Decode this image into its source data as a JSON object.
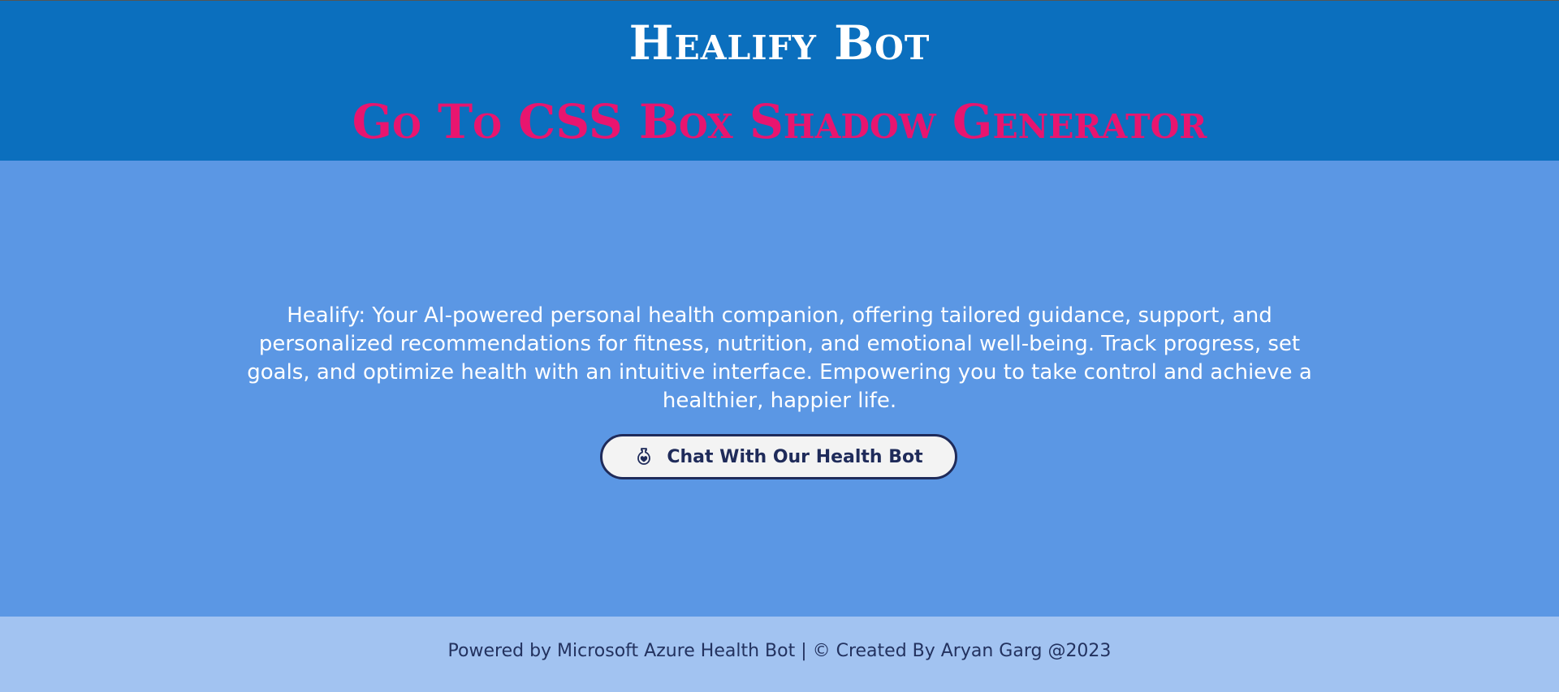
{
  "header": {
    "title": "Healify Bot",
    "link_label": "Go To CSS Box Shadow Generator"
  },
  "main": {
    "description": "Healify: Your AI-powered personal health companion, offering tailored guidance, support, and personalized recommendations for fitness, nutrition, and emotional well-being. Track progress, set goals, and optimize health with an intuitive interface. Empowering you to take control and achieve a healthier, happier life.",
    "chat_button": {
      "label": "Chat With Our Health Bot",
      "icon": "heart-potion-icon"
    }
  },
  "footer": {
    "text": "Powered by Microsoft Azure Health Bot | © Created By Aryan Garg @2023"
  },
  "colors": {
    "header_bg": "#0b6fbe",
    "link_color": "#e8156f",
    "main_bg": "#5b97e4",
    "button_border": "#1f2b5a",
    "footer_bg": "#a2c3f1",
    "footer_text": "#23325f"
  }
}
